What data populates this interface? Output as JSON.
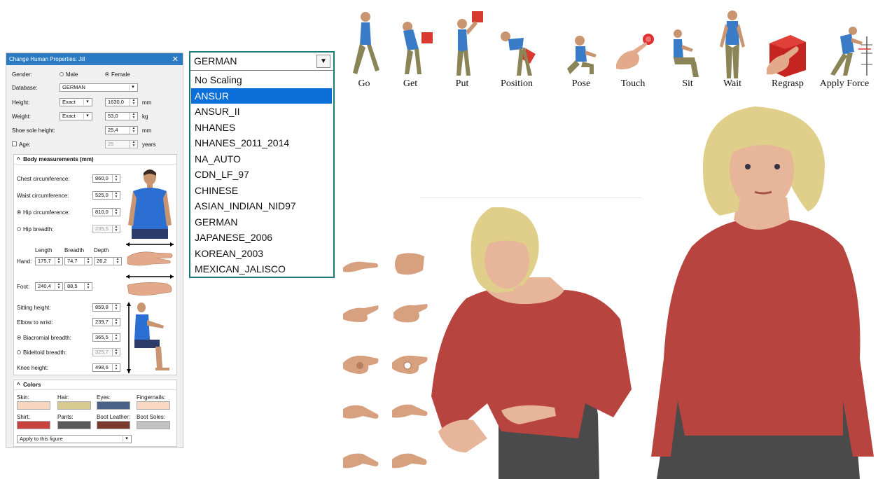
{
  "panel": {
    "title": "Change Human Properties: Jill",
    "gender": {
      "label": "Gender:",
      "male": "Male",
      "female": "Female",
      "selected": "Female"
    },
    "database": {
      "label": "Database:",
      "value": "GERMAN"
    },
    "height": {
      "label": "Height:",
      "mode": "Exact",
      "value": "1630,0",
      "unit": "mm"
    },
    "weight": {
      "label": "Weight:",
      "mode": "Exact",
      "value": "53,0",
      "unit": "kg"
    },
    "shoe_sole": {
      "label": "Shoe sole height:",
      "value": "25,4",
      "unit": "mm"
    },
    "age": {
      "label": "Age:",
      "value": "25",
      "unit": "years",
      "checked": false
    },
    "body": {
      "header": "Body measurements (mm)",
      "chest": {
        "label": "Chest circumference:",
        "value": "860,0"
      },
      "waist": {
        "label": "Waist circumference:",
        "value": "525,0"
      },
      "hip_circ": {
        "label": "Hip circumference:",
        "value": "810,0"
      },
      "hip_breadth": {
        "label": "Hip breadth:",
        "value": "235,5"
      },
      "hand": {
        "label": "Hand:",
        "length_label": "Length",
        "breadth_label": "Breadth",
        "depth_label": "Depth",
        "length": "175,7",
        "breadth": "74,7",
        "depth": "26,2"
      },
      "foot": {
        "label": "Foot:",
        "length": "240,4",
        "breadth": "88,5"
      },
      "sitting": {
        "label": "Sitting height:",
        "value": "859,8"
      },
      "elbow": {
        "label": "Elbow to wrist:",
        "value": "239,7"
      },
      "biacromial": {
        "label": "Biacromial breadth:",
        "value": "365,5"
      },
      "bideltoid": {
        "label": "Bideltoid breadth:",
        "value": "325,7"
      },
      "knee": {
        "label": "Knee height:",
        "value": "498,6"
      }
    },
    "colors": {
      "header": "Colors",
      "swatches": [
        {
          "label": "Skin:",
          "color": "#f7d6c0"
        },
        {
          "label": "Hair:",
          "color": "#d8c98e"
        },
        {
          "label": "Eyes:",
          "color": "#4a6187"
        },
        {
          "label": "Fingernails:",
          "color": "#f9d8c4"
        },
        {
          "label": "Shirt:",
          "color": "#c8433f"
        },
        {
          "label": "Pants:",
          "color": "#5a5a5a"
        },
        {
          "label": "Boot Leather:",
          "color": "#7a3a2e"
        },
        {
          "label": "Boot Soles:",
          "color": "#c2c2c2"
        }
      ],
      "apply": "Apply to this figure"
    }
  },
  "database_dropdown": {
    "selected": "GERMAN",
    "highlighted": "ANSUR",
    "options": [
      "No Scaling",
      "ANSUR",
      "ANSUR_II",
      "NHANES",
      "NHANES_2011_2014",
      "NA_AUTO",
      "CDN_LF_97",
      "CHINESE",
      "ASIAN_INDIAN_NID97",
      "GERMAN",
      "JAPANESE_2006",
      "KOREAN_2003",
      "MEXICAN_JALISCO"
    ]
  },
  "actions": [
    {
      "label": "Go",
      "icon": "walking-figure-icon"
    },
    {
      "label": "Get",
      "icon": "get-object-figure-icon"
    },
    {
      "label": "Put",
      "icon": "put-object-figure-icon"
    },
    {
      "label": "Position",
      "icon": "position-object-figure-icon"
    },
    {
      "label": "Pose",
      "icon": "kneeling-pose-figure-icon"
    },
    {
      "label": "Touch",
      "icon": "finger-touch-button-icon"
    },
    {
      "label": "Sit",
      "icon": "sitting-figure-icon"
    },
    {
      "label": "Wait",
      "icon": "standing-figure-icon"
    },
    {
      "label": "Regrasp",
      "icon": "hand-on-cube-icon"
    },
    {
      "label": "Apply Force",
      "icon": "push-force-figure-icon"
    }
  ],
  "colors": {
    "title_bar": "#2b7bc4",
    "highlight": "#0a6fd8",
    "dropdown_border": "#1f7a7a",
    "shirt_red": "#b8443f"
  }
}
